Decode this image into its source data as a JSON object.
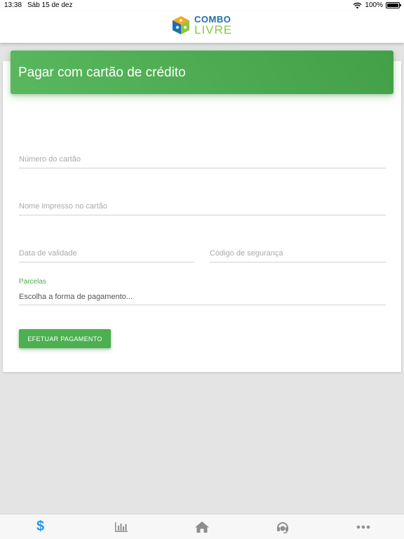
{
  "status_bar": {
    "time": "13:38",
    "date": "Sáb 15 de dez",
    "battery": "100%",
    "battery_level": 1.0
  },
  "header": {
    "logo_line1": "COMBO",
    "logo_line2": "LIVRE"
  },
  "card": {
    "title": "Pagar com cartão de crédito",
    "card_number_placeholder": "Número do cartão",
    "card_name_placeholder": "Nome impresso no cartão",
    "expiry_placeholder": "Data de validade",
    "cvv_placeholder": "Código de segurança",
    "installments_label": "Parcelas",
    "installments_value": "Escolha a forma de pagamento...",
    "pay_button_label": "EFETUAR PAGAMENTO"
  },
  "tabs": [
    {
      "icon": "dollar-icon",
      "glyph": "$",
      "active": true
    },
    {
      "icon": "bar-chart-icon",
      "active": false
    },
    {
      "icon": "home-icon",
      "active": false
    },
    {
      "icon": "headset-icon",
      "active": false
    },
    {
      "icon": "more-icon",
      "active": false
    }
  ],
  "colors": {
    "accent": "#4caf50",
    "active_tab": "#2196f3",
    "inactive_tab": "#8e8e8e"
  }
}
